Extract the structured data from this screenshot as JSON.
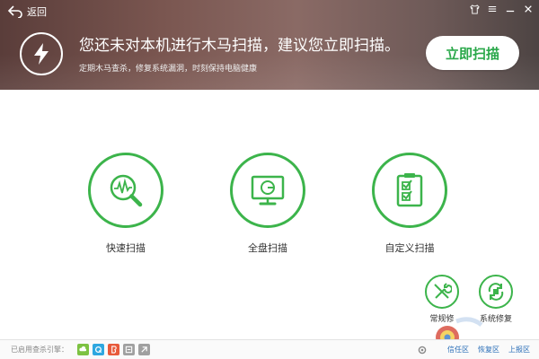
{
  "header": {
    "back_label": "返回",
    "headline": "您还未对本机进行木马扫描，建议您立即扫描。",
    "subline": "定期木马查杀，修复系统漏洞，时刻保持电脑健康",
    "scan_now_label": "立即扫描",
    "window_controls": [
      "shirt-icon",
      "menu-icon",
      "minimize-icon",
      "close-icon"
    ]
  },
  "scan_options": [
    {
      "label": "快速扫描",
      "icon": "magnifier-pulse-icon"
    },
    {
      "label": "全盘扫描",
      "icon": "monitor-icon"
    },
    {
      "label": "自定义扫描",
      "icon": "checklist-icon"
    }
  ],
  "tools": [
    {
      "label": "常规修",
      "icon": "wrench-screwdriver-icon"
    },
    {
      "label": "系统修复",
      "icon": "system-repair-icon"
    }
  ],
  "footer": {
    "engines_label": "已启用查杀引擎：",
    "engines": [
      {
        "icon": "cloud-engine-icon",
        "color": "#7dc242"
      },
      {
        "icon": "qvm-engine-icon",
        "color": "#2ea7e0"
      },
      {
        "icon": "bitdefender-engine-icon",
        "color": "#e85a3b"
      },
      {
        "icon": "avira-engine-icon",
        "color": "#a0a0a0"
      },
      {
        "icon": "system-engine-icon",
        "color": "#a0a0a0"
      }
    ],
    "links": [
      "信任区",
      "恢复区",
      "上报区"
    ]
  },
  "colors": {
    "accent": "#3cb44b",
    "button_text": "#2aa84a",
    "link": "#2b6fb8"
  }
}
